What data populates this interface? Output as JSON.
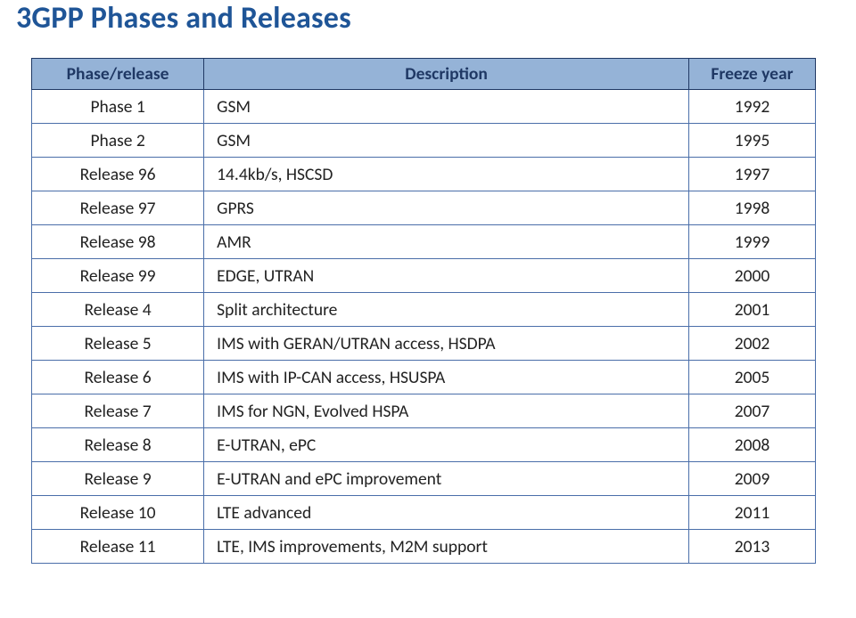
{
  "title": "3GPP Phases and Releases",
  "columns": {
    "phase": "Phase/release",
    "desc": "Description",
    "year": "Freeze year"
  },
  "chart_data": {
    "type": "table",
    "title": "3GPP Phases and Releases",
    "columns": [
      "Phase/release",
      "Description",
      "Freeze year"
    ],
    "rows": [
      [
        "Phase 1",
        "GSM",
        "1992"
      ],
      [
        "Phase 2",
        "GSM",
        "1995"
      ],
      [
        "Release 96",
        "14.4kb/s, HSCSD",
        "1997"
      ],
      [
        "Release 97",
        "GPRS",
        "1998"
      ],
      [
        "Release 98",
        "AMR",
        "1999"
      ],
      [
        "Release 99",
        "EDGE, UTRAN",
        "2000"
      ],
      [
        "Release 4",
        "Split architecture",
        "2001"
      ],
      [
        "Release 5",
        "IMS with GERAN/UTRAN access, HSDPA",
        "2002"
      ],
      [
        "Release 6",
        "IMS with IP-CAN access, HSUSPA",
        "2005"
      ],
      [
        "Release 7",
        "IMS for NGN, Evolved HSPA",
        "2007"
      ],
      [
        "Release 8",
        "E-UTRAN, ePC",
        "2008"
      ],
      [
        "Release 9",
        "E-UTRAN and ePC improvement",
        "2009"
      ],
      [
        "Release 10",
        "LTE advanced",
        "2011"
      ],
      [
        "Release 11",
        "LTE, IMS improvements, M2M support",
        "2013"
      ]
    ]
  }
}
